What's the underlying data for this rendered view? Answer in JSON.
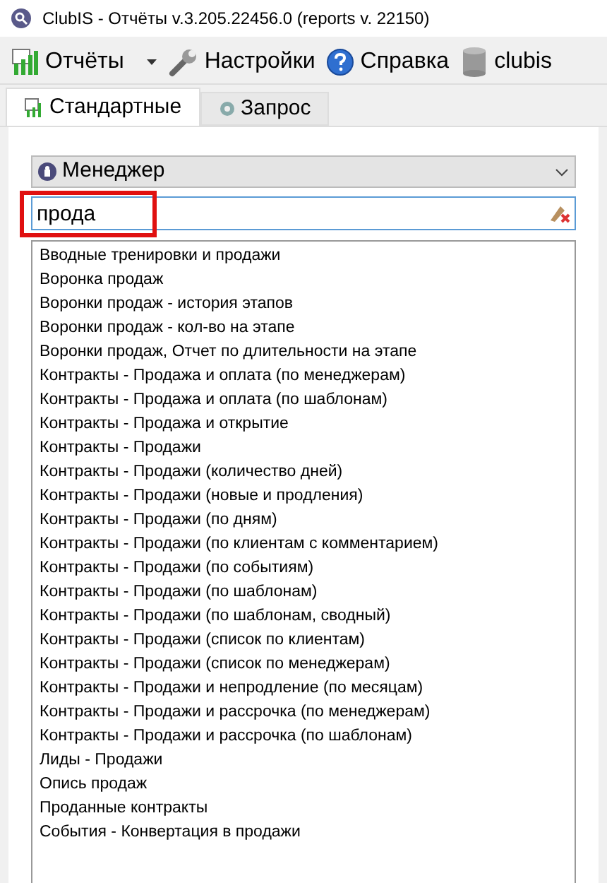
{
  "window": {
    "title": "ClubIS - Отчёты v.3.205.22456.0 (reports v. 22150)"
  },
  "toolbar": [
    {
      "kind": "reports",
      "label": "Отчёты"
    },
    {
      "kind": "settings",
      "label": "Настройки"
    },
    {
      "kind": "help",
      "label": "Справка"
    },
    {
      "kind": "db",
      "label": "clubis"
    }
  ],
  "tabs": [
    {
      "kind": "standard",
      "label": "Стандартные",
      "selected": true
    },
    {
      "kind": "query",
      "label": "Запрос",
      "selected": false
    }
  ],
  "category": {
    "value": "Менеджер"
  },
  "search": {
    "value": "прода",
    "highlighted": true
  },
  "reports": [
    "Вводные тренировки и продажи",
    "Воронка продаж",
    "Воронки продаж - история этапов",
    "Воронки продаж - кол-во на этапе",
    "Воронки продаж, Отчет по длительности на этапе",
    "Контракты - Продажа и оплата (по менеджерам)",
    "Контракты - Продажа и оплата (по шаблонам)",
    "Контракты - Продажа и открытие",
    "Контракты - Продажи",
    "Контракты - Продажи (количество дней)",
    "Контракты - Продажи (новые и продления)",
    "Контракты - Продажи (по дням)",
    "Контракты - Продажи (по клиентам с комментарием)",
    "Контракты - Продажи (по событиям)",
    "Контракты - Продажи (по шаблонам)",
    "Контракты - Продажи (по шаблонам, сводный)",
    "Контракты - Продажи (список по клиентам)",
    "Контракты - Продажи (список по менеджерам)",
    "Контракты - Продажи и непродление (по месяцам)",
    "Контракты - Продажи и рассрочка (по менеджерам)",
    "Контракты - Продажи и рассрочка (по шаблонам)",
    "Лиды - Продажи",
    "Опись продаж",
    "Проданные контракты",
    "События - Конвертация в продажи"
  ]
}
